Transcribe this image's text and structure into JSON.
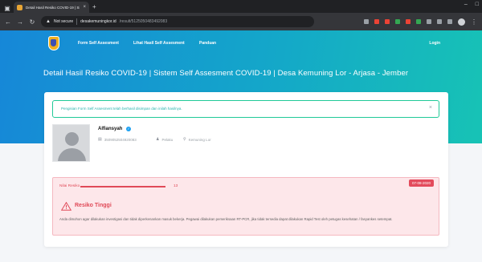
{
  "browser": {
    "tab_title": "Detail Hasil Resiko COVID-19 | Sis",
    "not_secure": "Not secure",
    "url_host": "desakemuningkor.id",
    "url_path": "/result/5125050483492083"
  },
  "nav": {
    "links": [
      "Form Self Assesment",
      "Lihat Hasil Self Assesment",
      "Panduan"
    ],
    "login": "Login"
  },
  "page_title": "Detail Hasil Resiko COVID-19 | Sistem Self Assesment COVID-19 | Desa Kemuning Lor - Arjasa - Jember",
  "info_alert": {
    "text": "Pengisian Form Self Assesment telah berhasil disimpan dan inilah hasilnya.",
    "close": "×"
  },
  "user": {
    "name": "Alfiansyah",
    "nik": "3509052504920083",
    "gender": "Pelaku",
    "location": "Kemuning Lor"
  },
  "risk": {
    "label": "Nilai Resiko",
    "count": "13",
    "date": "07-08-2020",
    "level": "Resiko Tinggi",
    "description": "Anda dimohon agar dilakukan investigasi dan tidak diperkenankan masuk bekerja. Pegawai dilakukan pemeriksaan RT-PCR, jika tidak tersedia dapat dilakukan Rapid Test oleh petugas kesehatan / fasyankes setempat."
  },
  "colors": {
    "hero_start": "#1687d8",
    "hero_end": "#17c3b5",
    "alert_border": "#20c997",
    "danger": "#e04a58",
    "danger_bg": "#fde7ea"
  }
}
